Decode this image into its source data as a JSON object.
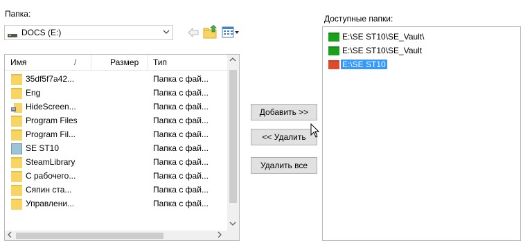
{
  "labels": {
    "folder": "Папка:",
    "available": "Доступные папки:"
  },
  "drive": {
    "value": "DOCS (E:)",
    "icon": "drive-icon",
    "dropdown_icon": "chevron-down-icon"
  },
  "toolbar": {
    "back_icon": "back-arrow-icon",
    "up_folder_icon": "folder-up-icon",
    "view_menu_icon": "view-menu-icon"
  },
  "columns": {
    "name": "Имя",
    "size": "Размер",
    "type": "Тип",
    "sort_glyph": "/"
  },
  "files": [
    {
      "name": "35df5f7a42...",
      "type": "Папка с фай...",
      "icon": "folder-icon"
    },
    {
      "name": "Eng",
      "type": "Папка с фай...",
      "icon": "folder-icon"
    },
    {
      "name": "HideScreen...",
      "type": "Папка с фай...",
      "icon": "app-folder-icon"
    },
    {
      "name": "Program Files",
      "type": "Папка с фай...",
      "icon": "folder-icon"
    },
    {
      "name": "Program Fil...",
      "type": "Папка с фай...",
      "icon": "folder-icon"
    },
    {
      "name": "SE ST10",
      "type": "Папка с фай...",
      "icon": "special-folder-icon"
    },
    {
      "name": "SteamLibrary",
      "type": "Папка с фай...",
      "icon": "folder-icon"
    },
    {
      "name": "С рабочего...",
      "type": "Папка с фай...",
      "icon": "folder-icon"
    },
    {
      "name": "Сяпин ста...",
      "type": "Папка с фай...",
      "icon": "folder-icon"
    },
    {
      "name": "Управлени...",
      "type": "Папка с фай...",
      "icon": "folder-icon"
    }
  ],
  "buttons": {
    "add": "Добавить >>",
    "remove": "<< Удалить",
    "remove_all": "Удалить все"
  },
  "available_folders": [
    {
      "path": "E:\\SE ST10\\SE_Vault\\",
      "color": "#1aa01a",
      "selected": false
    },
    {
      "path": "E:\\SE ST10\\SE_Vault",
      "color": "#1aa01a",
      "selected": false
    },
    {
      "path": "E:\\SE ST10",
      "color": "#e04a2a",
      "selected": true
    }
  ],
  "colors": {
    "selection": "#3399ff",
    "folder": "#f8d463"
  }
}
